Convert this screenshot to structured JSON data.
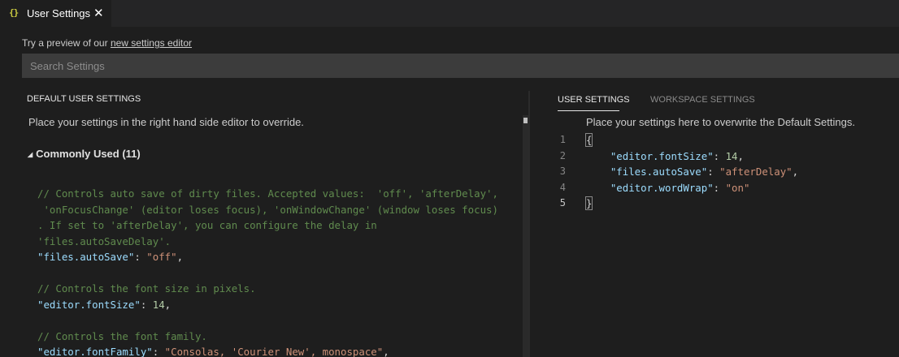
{
  "tab": {
    "icon": "{}",
    "label": "User Settings",
    "close_glyph": "✕"
  },
  "preview": {
    "prefix": "Try a preview of our ",
    "link": "new settings editor"
  },
  "search": {
    "placeholder": "Search Settings",
    "value": ""
  },
  "left_pane": {
    "title": "DEFAULT USER SETTINGS",
    "description": "Place your settings in the right hand side editor to override.",
    "group": {
      "expanded_glyph": "◢",
      "label": "Commonly Used (11)"
    },
    "code_lines": [
      [
        {
          "t": "comment",
          "v": "// Controls auto save of dirty files. Accepted values:  'off', 'afterDelay',"
        }
      ],
      [
        {
          "t": "comment",
          "v": " 'onFocusChange' (editor loses focus), 'onWindowChange' (window loses focus)"
        }
      ],
      [
        {
          "t": "comment",
          "v": ". If set to 'afterDelay', you can configure the delay in"
        }
      ],
      [
        {
          "t": "comment",
          "v": "'files.autoSaveDelay'."
        }
      ],
      [
        {
          "t": "key",
          "v": "\"files.autoSave\""
        },
        {
          "t": "punc",
          "v": ": "
        },
        {
          "t": "str",
          "v": "\"off\""
        },
        {
          "t": "punc",
          "v": ","
        }
      ],
      [
        {
          "t": "punc",
          "v": ""
        }
      ],
      [
        {
          "t": "comment",
          "v": "// Controls the font size in pixels."
        }
      ],
      [
        {
          "t": "key",
          "v": "\"editor.fontSize\""
        },
        {
          "t": "punc",
          "v": ": "
        },
        {
          "t": "num",
          "v": "14"
        },
        {
          "t": "punc",
          "v": ","
        }
      ],
      [
        {
          "t": "punc",
          "v": ""
        }
      ],
      [
        {
          "t": "comment",
          "v": "// Controls the font family."
        }
      ],
      [
        {
          "t": "key",
          "v": "\"editor.fontFamily\""
        },
        {
          "t": "punc",
          "v": ": "
        },
        {
          "t": "str",
          "v": "\"Consolas, 'Courier New', monospace\""
        },
        {
          "t": "punc",
          "v": ","
        }
      ]
    ]
  },
  "right_pane": {
    "tabs": [
      {
        "label": "USER SETTINGS",
        "active": true
      },
      {
        "label": "WORKSPACE SETTINGS",
        "active": false
      }
    ],
    "description": "Place your settings here to overwrite the Default Settings.",
    "line_numbers": [
      "1",
      "2",
      "3",
      "4",
      "5"
    ],
    "active_line": "5",
    "code_lines": [
      [
        {
          "t": "brace",
          "v": "{"
        }
      ],
      [
        {
          "t": "punc",
          "v": "    "
        },
        {
          "t": "key",
          "v": "\"editor.fontSize\""
        },
        {
          "t": "punc",
          "v": ": "
        },
        {
          "t": "num",
          "v": "14"
        },
        {
          "t": "punc",
          "v": ","
        }
      ],
      [
        {
          "t": "punc",
          "v": "    "
        },
        {
          "t": "key",
          "v": "\"files.autoSave\""
        },
        {
          "t": "punc",
          "v": ": "
        },
        {
          "t": "str",
          "v": "\"afterDelay\""
        },
        {
          "t": "punc",
          "v": ","
        }
      ],
      [
        {
          "t": "punc",
          "v": "    "
        },
        {
          "t": "key",
          "v": "\"editor.wordWrap\""
        },
        {
          "t": "punc",
          "v": ": "
        },
        {
          "t": "str",
          "v": "\"on\""
        }
      ],
      [
        {
          "t": "brace",
          "v": "}"
        }
      ]
    ]
  },
  "colors": {
    "background": "#1e1e1e",
    "tab_bar": "#252526",
    "search_background": "#3c3c3c",
    "comment": "#608b4e",
    "key": "#9cdcfe",
    "string": "#ce9178",
    "number": "#b5cea8",
    "json_icon": "#cbcb41"
  }
}
